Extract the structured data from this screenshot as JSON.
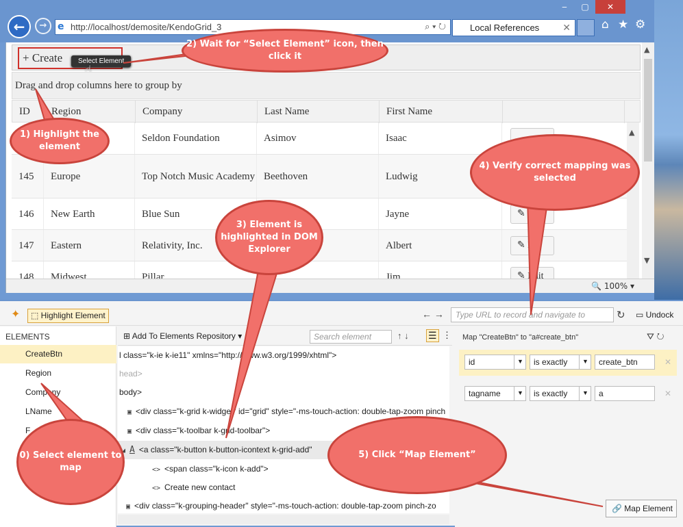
{
  "browser": {
    "url": "http://localhost/demosite/KendoGrid_3",
    "tab_title": "Local References",
    "window_buttons": [
      "‒",
      "▢",
      "✕"
    ]
  },
  "grid": {
    "toolbar_button": "+ Create",
    "tooltip": "Select Element",
    "grouping_text": "Drag and drop columns here to group by",
    "columns": [
      "ID",
      "Region",
      "Company",
      "Last Name",
      "First Name"
    ],
    "rows": [
      {
        "id": "",
        "region": "",
        "company": "Seldon Foundation",
        "last": "Asimov",
        "first": "Isaac",
        "action": ""
      },
      {
        "id": "145",
        "region": "Europe",
        "company": "Top Notch Music Academy",
        "last": "Beethoven",
        "first": "Ludwig",
        "action": ""
      },
      {
        "id": "146",
        "region": "New Earth",
        "company": "Blue Sun",
        "last": "",
        "first": "Jayne",
        "action": "Ed"
      },
      {
        "id": "147",
        "region": "Eastern",
        "company": "Relativity, Inc.",
        "last": "",
        "first": "Albert",
        "action": "E"
      },
      {
        "id": "148",
        "region": "Midwest",
        "company": "Pillar",
        "last": "",
        "first": "Jim",
        "action": "Edit"
      }
    ],
    "zoom": "100%"
  },
  "tool": {
    "highlight_label": "Highlight Element",
    "url_placeholder": "Type URL to record and navigate to",
    "undock_label": "Undock",
    "elements_title": "ELEMENTS",
    "elements": [
      "CreateBtn",
      "Region",
      "Company",
      "LName",
      "F"
    ],
    "add_repo_label": "Add To Elements Repository",
    "search_placeholder": "Search element",
    "dom_lines": [
      "l class=\"k-ie k-ie11\" xmlns=\"http://www.w3.org/1999/xhtml\">",
      "head>",
      "body>",
      "<div class=\"k-grid k-widget\" id=\"grid\" style=\"-ms-touch-action: double-tap-zoom pinch",
      "<div class=\"k-toolbar k-grid-toolbar\">",
      "<a class=\"k-button k-button-icontext k-grid-add\"",
      "<span class=\"k-icon k-add\">",
      "Create new contact",
      "<div class=\"k-grouping-header\" style=\"-ms-touch-action: double-tap-zoom pinch-zo"
    ],
    "map_title": "Map \"CreateBtn\" to \"a#create_btn\"",
    "criteria": [
      {
        "attr": "id",
        "op": "is exactly",
        "value": "create_btn"
      },
      {
        "attr": "tagname",
        "op": "is exactly",
        "value": "a"
      }
    ],
    "map_button": "Map Element"
  },
  "callouts": {
    "c0": "0) Select element to map",
    "c1": "1) Highlight the element",
    "c2": "2) Wait for “Select Element” icon, then click it",
    "c3": "3) Element is highlighted in DOM Explorer",
    "c4": "4) Verify correct mapping was selected",
    "c5": "5) Click “Map Element”"
  },
  "colors": {
    "callout_fill": "#f1706a",
    "callout_border": "#c9443c",
    "highlight": "#fdf1c4",
    "chrome": "#6a95cf"
  }
}
